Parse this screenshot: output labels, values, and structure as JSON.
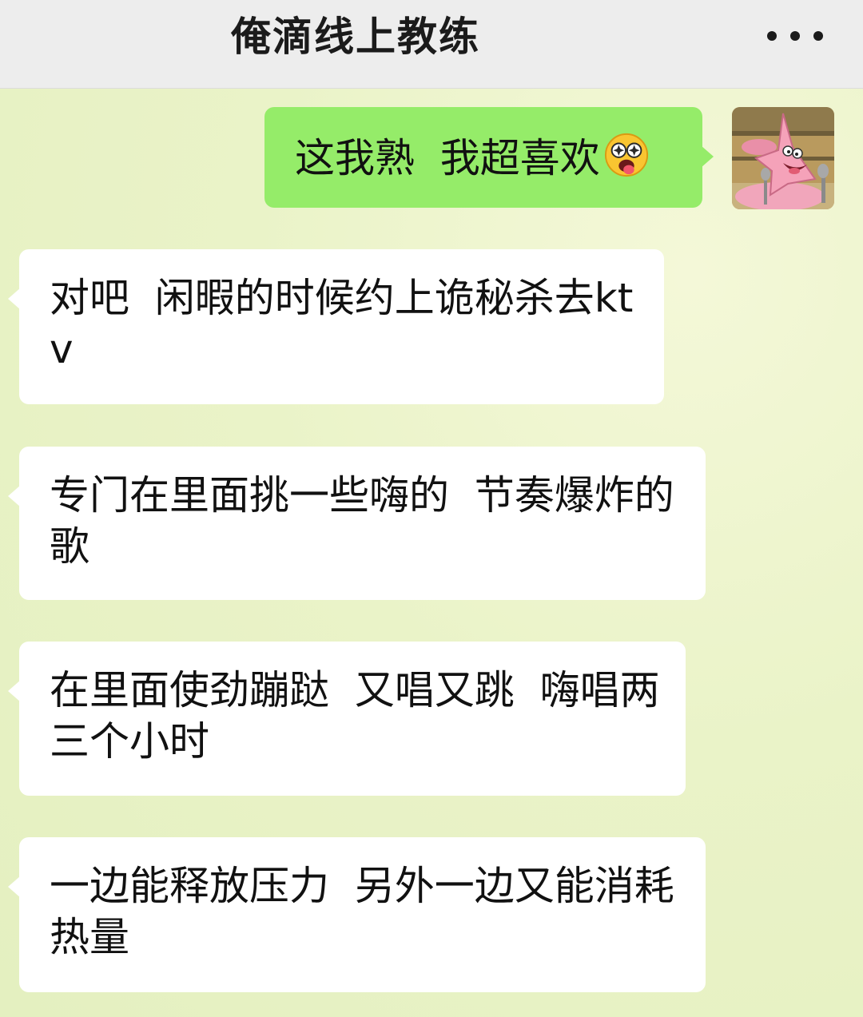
{
  "header": {
    "title": "俺滴线上教练",
    "more_icon": "more-dots-icon"
  },
  "messages": [
    {
      "side": "sent",
      "text": "这我熟  我超喜欢",
      "emoji": "starstruck-tongue-emoji",
      "avatar": "patrick-star-avatar"
    },
    {
      "side": "received",
      "text": "对吧  闲暇的时候约上诡秘杀去ktv"
    },
    {
      "side": "received",
      "text": "专门在里面挑一些嗨的  节奏爆炸的歌"
    },
    {
      "side": "received",
      "text": "在里面使劲蹦跶  又唱又跳  嗨唱两三个小时"
    },
    {
      "side": "received",
      "text": "一边能释放压力  另外一边又能消耗热量"
    }
  ],
  "colors": {
    "sent_bubble": "#95ec69",
    "received_bubble": "#ffffff",
    "header_bg": "#ededed",
    "chat_bg": "#eaf3c8"
  }
}
